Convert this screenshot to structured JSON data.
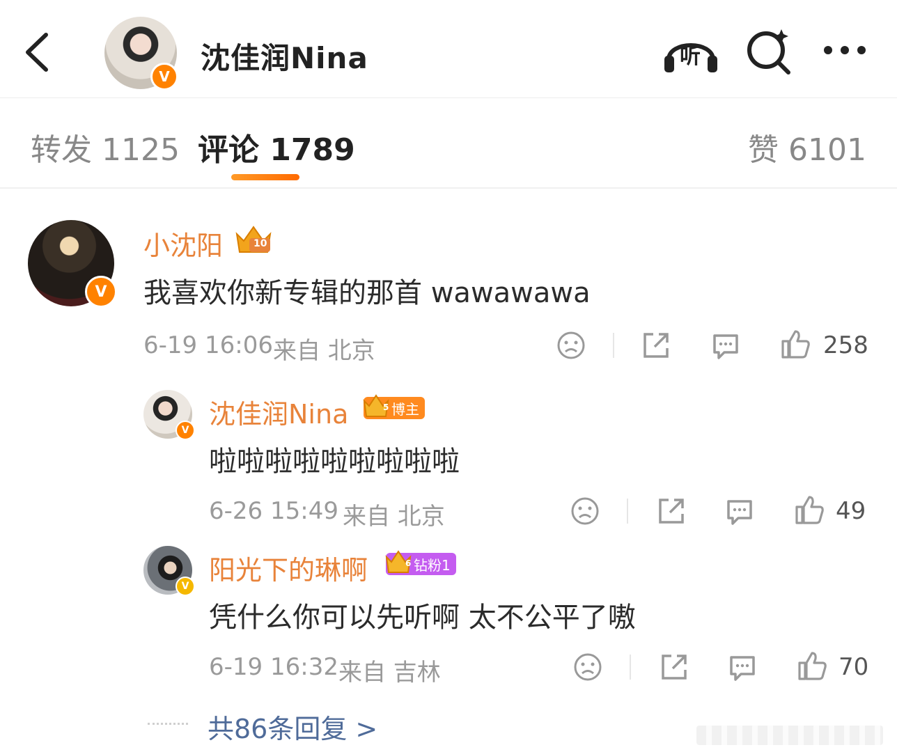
{
  "header": {
    "name": "沈佳润Nina",
    "listen_label": "听"
  },
  "tabs": {
    "repost": "转发 1125",
    "comment": "评论 1789",
    "like": "赞 6101"
  },
  "colors": {
    "accent_orange": "#ff8200",
    "username_orange": "#e8833a",
    "link_blue": "#4f6b99",
    "blogger_badge": "#ff8a1f",
    "fan_badge": "#c45cf0"
  },
  "comments": [
    {
      "user": "小沈阳",
      "crown_level": "10",
      "text": "我喜欢你新专辑的那首 wawawawa",
      "time": "6-19 16:06",
      "location": "来自 北京",
      "likes": "258"
    },
    {
      "user": "沈佳润Nina",
      "crown_level": "5",
      "badge": "博主",
      "text": "啦啦啦啦啦啦啦啦啦",
      "time": "6-26 15:49",
      "location": "来自 北京",
      "likes": "49"
    },
    {
      "user": "阳光下的琳啊",
      "crown_level": "6",
      "badge": "钻粉1",
      "text": "凭什么你可以先听啊 太不公平了嗷",
      "time": "6-19 16:32",
      "location": "来自 吉林",
      "likes": "70"
    }
  ],
  "more_replies": "共86条回复 >",
  "verified_mark": "V"
}
